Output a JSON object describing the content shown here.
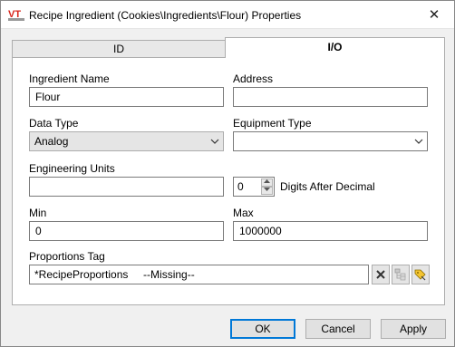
{
  "window": {
    "title": "Recipe Ingredient (Cookies\\Ingredients\\Flour) Properties",
    "close_glyph": "✕"
  },
  "tabs": [
    {
      "label": "ID",
      "active": false
    },
    {
      "label": "I/O",
      "active": true
    }
  ],
  "form": {
    "ingredient_name": {
      "label": "Ingredient Name",
      "value": "Flour"
    },
    "address": {
      "label": "Address",
      "value": ""
    },
    "data_type": {
      "label": "Data Type",
      "value": "Analog"
    },
    "equipment_type": {
      "label": "Equipment Type",
      "value": ""
    },
    "engineering_units": {
      "label": "Engineering Units",
      "value": ""
    },
    "digits_after_decimal": {
      "label": "Digits After Decimal",
      "value": "0"
    },
    "min": {
      "label": "Min",
      "value": "0"
    },
    "max": {
      "label": "Max",
      "value": "1000000"
    },
    "proportions_tag": {
      "label": "Proportions Tag",
      "value": "*RecipeProportions     --Missing--"
    }
  },
  "tag_buttons": [
    {
      "icon": "clear-x-icon"
    },
    {
      "icon": "tag-tree-icon"
    },
    {
      "icon": "tag-browse-icon"
    }
  ],
  "buttons": {
    "ok": "OK",
    "cancel": "Cancel",
    "apply": "Apply"
  },
  "colors": {
    "accent": "#0078d7",
    "logo_red": "#d9261c"
  }
}
